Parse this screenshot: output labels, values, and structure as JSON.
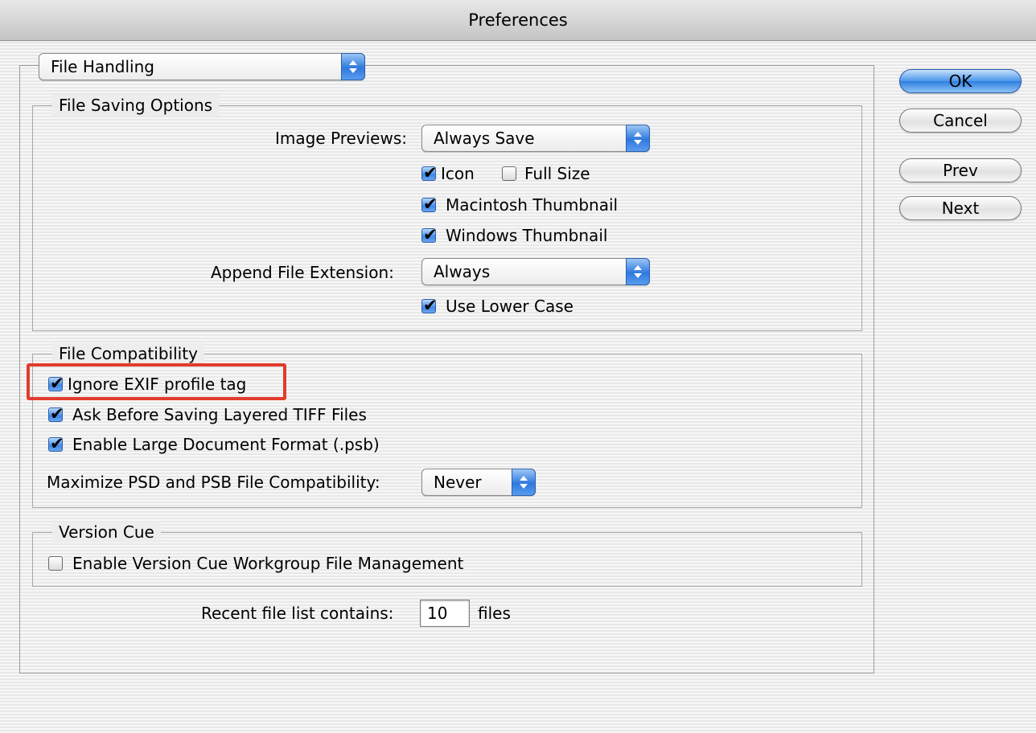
{
  "window": {
    "title": "Preferences"
  },
  "category_popup": {
    "value": "File Handling"
  },
  "buttons": {
    "ok": "OK",
    "cancel": "Cancel",
    "prev": "Prev",
    "next": "Next"
  },
  "file_saving": {
    "title": "File Saving Options",
    "image_previews_label": "Image Previews:",
    "image_previews_value": "Always Save",
    "icon_label": "Icon",
    "icon_checked": true,
    "full_size_label": "Full Size",
    "full_size_checked": false,
    "mac_thumb_label": "Macintosh Thumbnail",
    "mac_thumb_checked": true,
    "win_thumb_label": "Windows Thumbnail",
    "win_thumb_checked": true,
    "append_ext_label": "Append File Extension:",
    "append_ext_value": "Always",
    "lower_case_label": "Use Lower Case",
    "lower_case_checked": true
  },
  "file_compat": {
    "title": "File Compatibility",
    "ignore_exif_label": "Ignore EXIF profile tag",
    "ignore_exif_checked": true,
    "ask_tiff_label": "Ask Before Saving Layered TIFF Files",
    "ask_tiff_checked": true,
    "large_doc_label": "Enable Large Document Format (.psb)",
    "large_doc_checked": true,
    "maximize_label": "Maximize PSD and PSB File Compatibility:",
    "maximize_value": "Never"
  },
  "version_cue": {
    "title": "Version Cue",
    "enable_label": "Enable Version Cue Workgroup File Management",
    "enable_checked": false
  },
  "recent": {
    "label": "Recent file list contains:",
    "value": "10",
    "suffix": "files"
  },
  "colors": {
    "highlight": "#e23b2c",
    "accent": "#3f88e6"
  }
}
